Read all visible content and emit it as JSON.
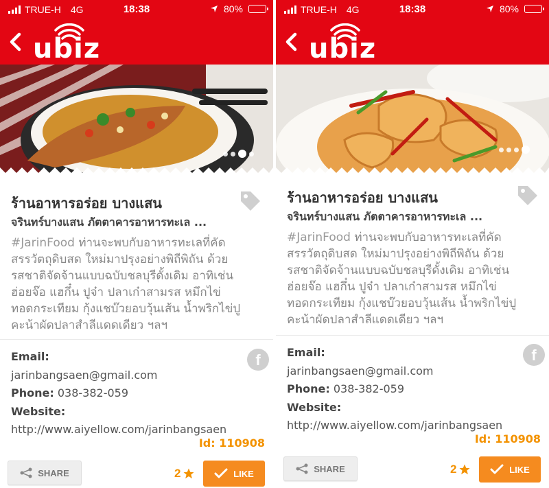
{
  "colors": {
    "brand_red": "#e30613",
    "accent_orange": "#f58b1f",
    "id_orange": "#f39200"
  },
  "statusbar": {
    "carrier": "TRUE-H",
    "network": "4G",
    "time": "18:38",
    "battery_text": "80%",
    "battery_level": 0.8,
    "location_icon": "location-arrow-icon"
  },
  "appbar": {
    "back_icon": "chevron-left-icon",
    "logo_text": "ubiz"
  },
  "screens": [
    {
      "carousel": {
        "total": 4,
        "active_index": 2,
        "image": "steamed-fish-dish"
      },
      "title": "ร้านอาหารอร่อย บางแสน",
      "subtitle": "จรินทร์บางแสน ภัตตาคารอาหารทะเล ...",
      "description": {
        "hashtag": "#JarinFood",
        "lines": [
          "ท่านจะพบกับอาหารทะเลที่คัด",
          "สรรวัตถุดิบสด ใหม่มาปรุงอย่างพิถีพิถัน ด้วย",
          "รสชาติจัดจ้านแบบฉบับชลบุรีดั้งเดิม อาทิเช่น",
          "ฮ่อยจ๊อ แฮกึ๋น ปูจ๋า ปลาเก๋าสามรส หมึกไข่",
          "ทอดกระเทียม กุ้งแชบ๊วยอบวุ้นเส้น น้ำพริกไข่ปู",
          "คะน้าผัดปลาสำลีแดดเดียว ฯลฯ"
        ]
      },
      "contact": {
        "email_label": "Email:",
        "email": "jarinbangsaen@gmail.com",
        "phone_label": "Phone:",
        "phone": "038-382-059",
        "website_label": "Website:",
        "website": "http://www.aiyellow.com/jarinbangsaen"
      },
      "id_text": "Id: 110908",
      "share_label": "SHARE",
      "like_count": "2",
      "like_label": "LIKE"
    },
    {
      "carousel": {
        "total": 4,
        "active_index": 3,
        "image": "stir-fried-squid-dish"
      },
      "title": "ร้านอาหารอร่อย บางแสน",
      "subtitle": "จรินทร์บางแสน ภัตตาคารอาหารทะเล ...",
      "description": {
        "hashtag": "#JarinFood",
        "lines": [
          "ท่านจะพบกับอาหารทะเลที่คัด",
          "สรรวัตถุดิบสด ใหม่มาปรุงอย่างพิถีพิถัน ด้วย",
          "รสชาติจัดจ้านแบบฉบับชลบุรีดั้งเดิม อาทิเช่น",
          "ฮ่อยจ๊อ แฮกึ๋น ปูจ๋า ปลาเก๋าสามรส หมึกไข่",
          "ทอดกระเทียม กุ้งแชบ๊วยอบวุ้นเส้น น้ำพริกไข่ปู",
          "คะน้าผัดปลาสำลีแดดเดียว ฯลฯ"
        ]
      },
      "contact": {
        "email_label": "Email:",
        "email": "jarinbangsaen@gmail.com",
        "phone_label": "Phone:",
        "phone": "038-382-059",
        "website_label": "Website:",
        "website": "http://www.aiyellow.com/jarinbangsaen"
      },
      "id_text": "Id: 110908",
      "share_label": "SHARE",
      "like_count": "2",
      "like_label": "LIKE"
    }
  ]
}
